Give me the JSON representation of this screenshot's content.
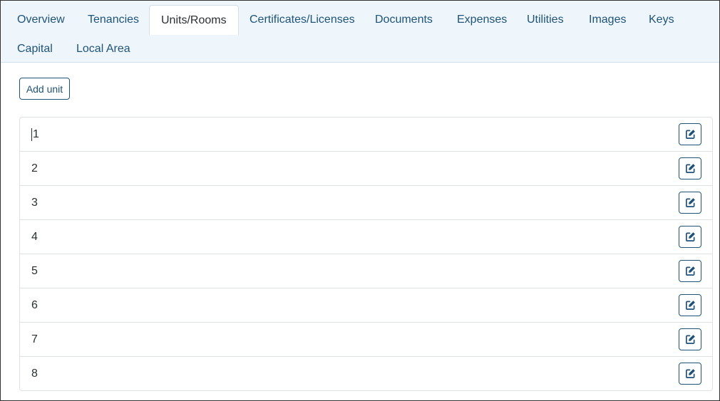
{
  "tabs": [
    {
      "label": "Overview"
    },
    {
      "label": "Tenancies"
    },
    {
      "label": "Units/Rooms",
      "active": true
    },
    {
      "label": "Certificates/Licenses"
    },
    {
      "label": "Documents"
    },
    {
      "label": "Expenses"
    },
    {
      "label": "Utilities"
    },
    {
      "label": "Images"
    },
    {
      "label": "Keys"
    },
    {
      "label": "Capital"
    },
    {
      "label": "Local Area"
    }
  ],
  "toolbar": {
    "add_unit_label": "Add unit"
  },
  "units": [
    {
      "name": "1"
    },
    {
      "name": "2"
    },
    {
      "name": "3"
    },
    {
      "name": "4"
    },
    {
      "name": "5"
    },
    {
      "name": "6"
    },
    {
      "name": "7"
    },
    {
      "name": "8"
    }
  ],
  "icons": {
    "edit": "edit-icon"
  },
  "colors": {
    "accent": "#1f5378",
    "tabbar_background": "#eef6fc",
    "border": "#dde2e6"
  }
}
